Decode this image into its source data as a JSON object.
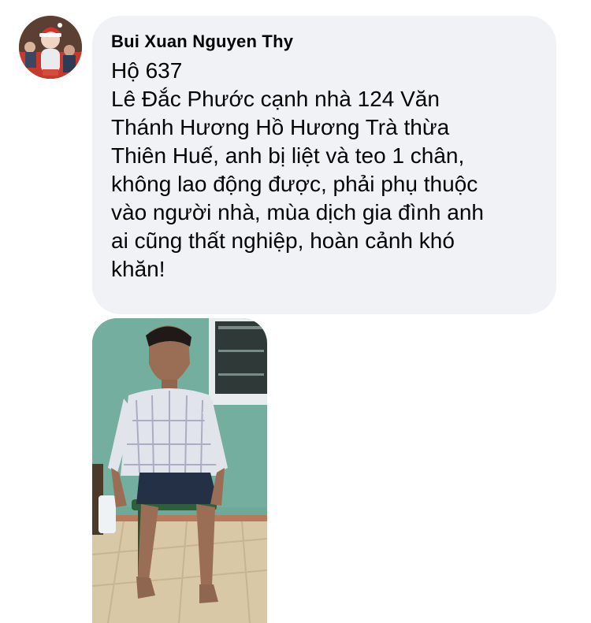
{
  "comment": {
    "author": "Bui Xuan Nguyen Thy",
    "lines": [
      "Hộ 637",
      "Lê Đắc Phước cạnh nhà 124 Văn",
      "Thánh Hương Hồ Hương Trà thừa",
      "Thiên Huế, anh bị liệt và teo 1 chân,",
      "không lao động được, phải phụ thuộc",
      "vào người nhà, mùa dịch gia đình anh",
      "ai cũng thất nghiệp, hoàn cảnh khó",
      "khăn!"
    ]
  },
  "colors": {
    "bubble_bg": "#f0f2f5",
    "text": "#050505",
    "wall": "#6fa99a"
  }
}
